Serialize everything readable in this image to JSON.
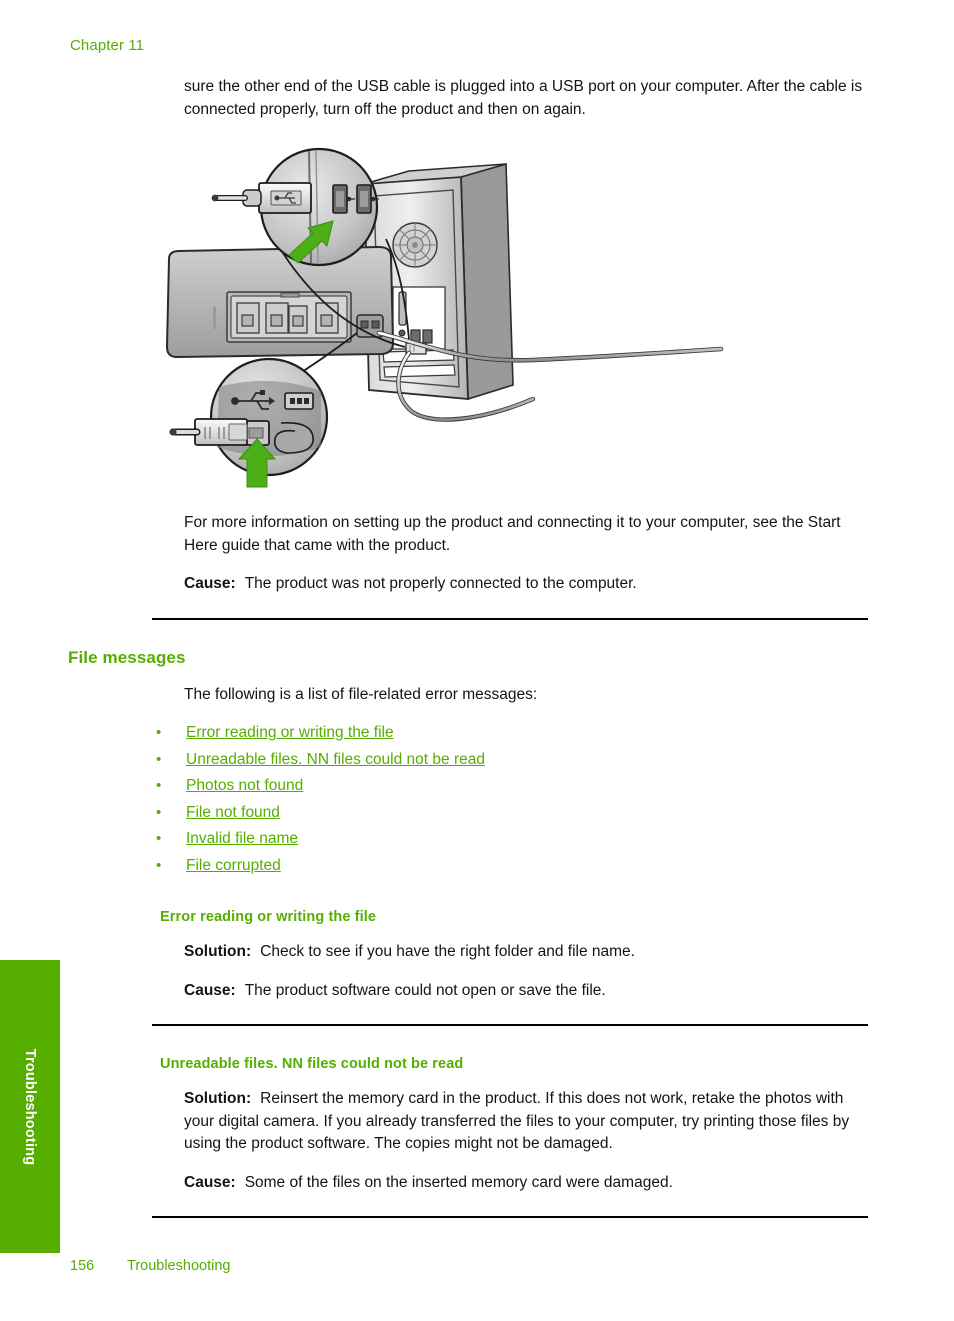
{
  "page": {
    "running_head": "Chapter 11",
    "footer_page_number": "156",
    "footer_section": "Troubleshooting",
    "side_tab_label": "Troubleshooting",
    "accent_green": "#55AE00",
    "text_black": "#141414"
  },
  "intro": {
    "paragraph": "sure the other end of the USB cable is plugged into a USB port on your computer. After the cable is connected properly, turn off the product and then on again."
  },
  "figure": {
    "name": "usb-connection-diagram",
    "alt": "Printer rear panel connected by USB cable to a computer tower, with two magnified callout circles showing the USB plug being inserted into the computer USB port and into the product USB port"
  },
  "after_figure": {
    "paragraph": "For more information on setting up the product and connecting it to your computer, see the Start Here guide that came with the product.",
    "cause_label": "Cause:",
    "cause_text": "The product was not properly connected to the computer."
  },
  "file_messages": {
    "heading": "File messages",
    "intro": "The following is a list of file-related error messages:",
    "links": [
      {
        "bullet": "•",
        "label": "Error reading or writing the file"
      },
      {
        "bullet": "•",
        "label": "Unreadable files. NN files could not be read"
      },
      {
        "bullet": "•",
        "label": "Photos not found"
      },
      {
        "bullet": "•",
        "label": "File not found"
      },
      {
        "bullet": "•",
        "label": "Invalid file name"
      },
      {
        "bullet": "•",
        "label": "File corrupted"
      }
    ]
  },
  "section_error_reading": {
    "heading": "Error reading or writing the file",
    "solution_label": "Solution:",
    "solution_text": "Check to see if you have the right folder and file name.",
    "cause_label": "Cause:",
    "cause_text": "The product software could not open or save the file."
  },
  "section_unreadable_files": {
    "heading": "Unreadable files. NN files could not be read",
    "solution_label": "Solution:",
    "solution_text": "Reinsert the memory card in the product. If this does not work, retake the photos with your digital camera. If you already transferred the files to your computer, try printing those files by using the product software. The copies might not be damaged.",
    "cause_label": "Cause:",
    "cause_text": "Some of the files on the inserted memory card were damaged."
  }
}
